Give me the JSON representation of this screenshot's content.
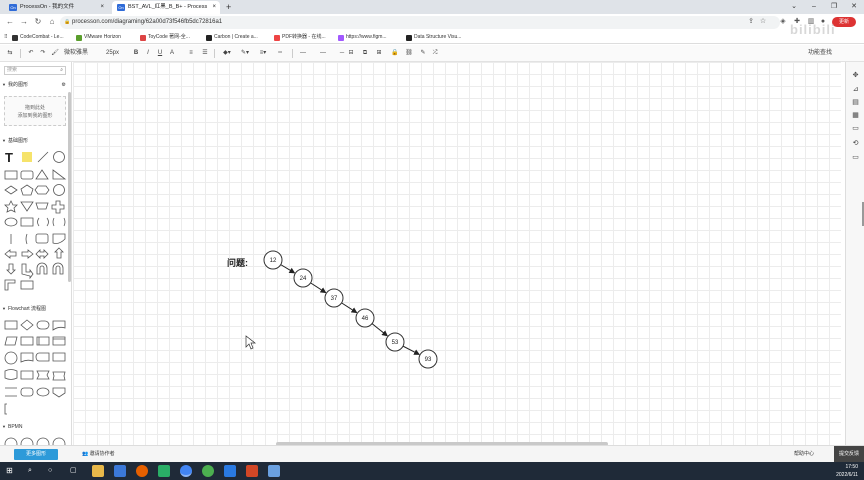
{
  "browser": {
    "tabs": [
      {
        "title": "ProcessOn - 我的文件",
        "favicon": "On"
      },
      {
        "title": "BST_AVL_红黑_B_B+ - Process",
        "favicon": "On"
      }
    ],
    "url": "processon.com/diagraming/62a00d73f546fb5dc72816a1",
    "profile_label": "更新"
  },
  "bookmarks": [
    {
      "label": "CodeCombat - Le...",
      "color": "#333"
    },
    {
      "label": "VMware Horizon",
      "color": "#5a9e2c"
    },
    {
      "label": "ToyCode 著网-全...",
      "color": "#d44"
    },
    {
      "label": "Carbon | Create a...",
      "color": "#222"
    },
    {
      "label": "PDF转换器 - 在线...",
      "color": "#e44"
    },
    {
      "label": "https://www.figm...",
      "color": "#a259ff"
    },
    {
      "label": "Data Structure Visu...",
      "color": "#222"
    }
  ],
  "toolbar": {
    "font_family": "微软雅黑",
    "font_size": "25px",
    "bold": "B",
    "italic": "I",
    "underline": "U",
    "font_color": "A",
    "function_search": "功能查找"
  },
  "left_panel": {
    "search_placeholder": "搜索",
    "my_shapes_title": "我的图形",
    "dropzone_line1": "拖到此处",
    "dropzone_line2": "添加到我的图形",
    "basic_title": "基础图形",
    "flowchart_title": "Flowchart 流程图",
    "bpmn_title": "BPMN",
    "text_tool": "T"
  },
  "canvas": {
    "question_label": "问题:",
    "nodes": [
      "12",
      "24",
      "37",
      "46",
      "53",
      "93"
    ]
  },
  "bottom_bar": {
    "more_shapes": "更多图形",
    "invite": "邀请协作者",
    "help": "帮助中心",
    "feedback": "提交反馈"
  },
  "taskbar": {
    "time": "17:50",
    "date": "2022/6/11"
  },
  "watermark": "bilibili",
  "colors": {
    "accent": "#2d9ad9",
    "taskbar": "#1f2a38",
    "node_stroke": "#333333"
  }
}
